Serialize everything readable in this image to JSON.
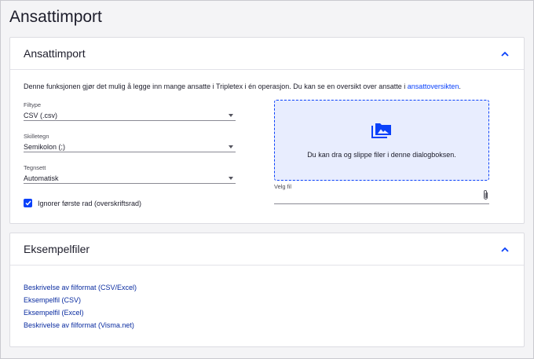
{
  "page": {
    "title": "Ansattimport"
  },
  "import_card": {
    "title": "Ansattimport",
    "intro_text": "Denne funksjonen gjør det mulig å legge inn mange ansatte i Tripletex i én operasjon. Du kan se en oversikt over ansatte i ",
    "intro_link": "ansattoversikten",
    "intro_end": ".",
    "fields": {
      "filetype": {
        "label": "Filtype",
        "value": "CSV (.csv)"
      },
      "separator": {
        "label": "Skilletegn",
        "value": "Semikolon (;)"
      },
      "charset": {
        "label": "Tegnsett",
        "value": "Automatisk"
      }
    },
    "ignore_first_row": {
      "label": "Ignorer første rad (overskriftsrad)",
      "checked": true
    },
    "dropzone_text": "Du kan dra og slippe filer i denne dialogboksen.",
    "file_label": "Velg fil"
  },
  "examples_card": {
    "title": "Eksempelfiler",
    "links": [
      "Beskrivelse av filformat (CSV/Excel)",
      "Eksempelfil (CSV)",
      "Eksempelfil (Excel)",
      "Beskrivelse av filformat (Visma.net)"
    ]
  },
  "colors": {
    "accent": "#0a41fa",
    "dropzone_bg": "#e8edfe"
  }
}
